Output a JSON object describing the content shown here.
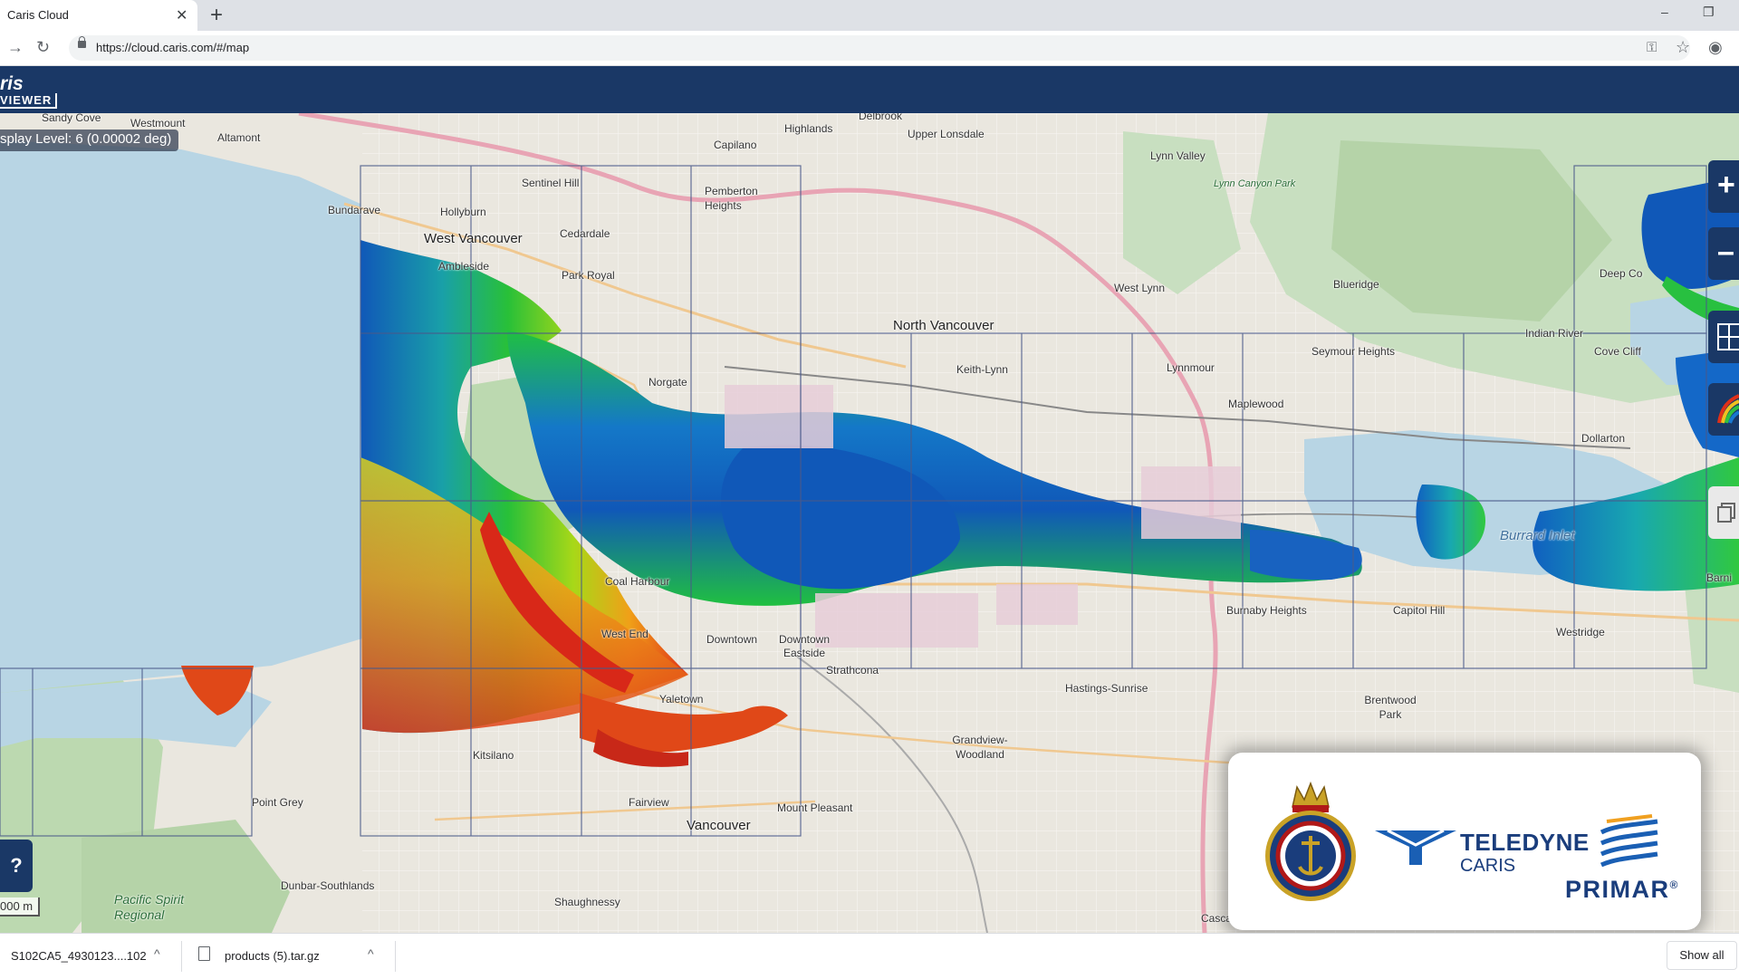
{
  "browser": {
    "tab_title": "Caris Cloud",
    "tab_close": "✕",
    "new_tab": "+",
    "url": "https://cloud.caris.com/#/map",
    "window_controls": [
      "–",
      "❐"
    ]
  },
  "app": {
    "logo_main": "ris",
    "logo_sub": "VIEWER"
  },
  "map": {
    "display_level": "splay Level: 6 (0.00002 deg)",
    "zoom_in": "+",
    "zoom_out": "–",
    "help": "?",
    "scale": "000 m",
    "labels": {
      "sandy_cove": "Sandy Cove",
      "westmount": "Westmount",
      "altamont": "Altamont",
      "capilano": "Capilano",
      "highlands": "Highlands",
      "delbrook": "Delbrook",
      "upper_lonsdale": "Upper Lonsdale",
      "lynn_valley": "Lynn Valley",
      "lynn_canyon_park": "Lynn Canyon Park",
      "sentinel_hill": "Sentinel Hill",
      "pemberton_heights": "Pemberton Heights",
      "bundarave": "Bundarave",
      "hollyburn": "Hollyburn",
      "west_vancouver": "West Vancouver",
      "cedardale": "Cedardale",
      "ambleside": "Ambleside",
      "park_royal": "Park Royal",
      "west_lynn": "West Lynn",
      "blueridge": "Blueridge",
      "deep_cove": "Deep Co",
      "north_vancouver": "North Vancouver",
      "keith_lynn": "Keith-Lynn",
      "lynnmour": "Lynnmour",
      "seymour_heights": "Seymour Heights",
      "indian_river": "Indian River",
      "cove_cliff": "Cove Cliff",
      "maplewood": "Maplewood",
      "norgate": "Norgate",
      "dollarton": "Dollarton",
      "burrard_inlet": "Burrard Inlet",
      "coal_harbour": "Coal Harbour",
      "west_end": "West End",
      "downtown": "Downtown",
      "downtown_eastside": "Downtown Eastside",
      "burnaby_heights": "Burnaby Heights",
      "capitol_hill": "Capitol Hill",
      "westridge": "Westridge",
      "strathcona": "Strathcona",
      "hastings_sunrise": "Hastings-Sunrise",
      "brentwood_park": "Brentwood Park",
      "yaletown": "Yaletown",
      "kitsilano": "Kitsilano",
      "grandview_woodland": "Grandview-Woodland",
      "point_grey": "Point Grey",
      "fairview": "Fairview",
      "mount_pleasant": "Mount Pleasant",
      "vancouver": "Vancouver",
      "dunbar_southlands": "Dunbar-Southlands",
      "shaughnessy": "Shaughnessy",
      "pacific_spirit": "Pacific Spirit Regional",
      "cascade": "Casca",
      "barnet": "Barni"
    }
  },
  "downloads": {
    "item1_name": "S102CA5_4930123....102",
    "item2_name": "products (5).tar.gz",
    "chevron": "^",
    "show_all": "Show all"
  },
  "logos": {
    "teledyne": "TELEDYNE",
    "caris": "CARIS",
    "primar": "PRIMAR",
    "primar_reg": "®"
  },
  "colors": {
    "app_header": "#1a3866",
    "deep_water": "#1058b8",
    "mid_water": "#18c040",
    "shallow_water": "#e03018",
    "sea_background": "#b8d5e4"
  }
}
